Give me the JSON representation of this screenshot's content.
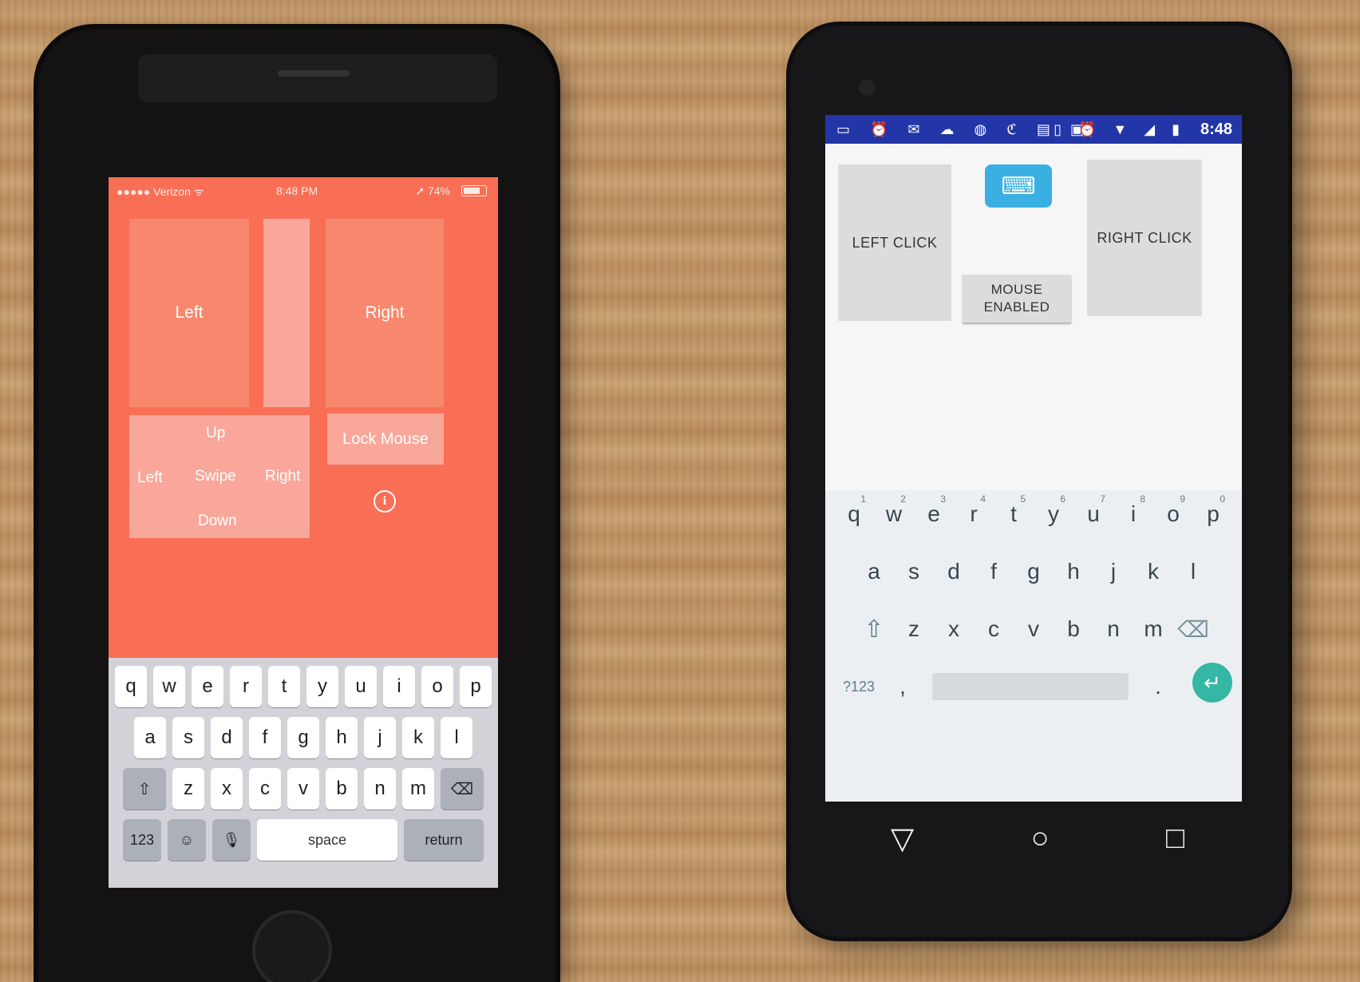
{
  "iphone": {
    "status": {
      "carrier": "●●●●● Verizon ᯤ",
      "time": "8:48 PM",
      "battery": "➚ 74%"
    },
    "pads": {
      "left": "Left",
      "right": "Right",
      "lock": "Lock Mouse"
    },
    "swipe": {
      "up": "Up",
      "left": "Left",
      "center": "Swipe",
      "right": "Right",
      "down": "Down"
    },
    "keyboard": {
      "row1": [
        "q",
        "w",
        "e",
        "r",
        "t",
        "y",
        "u",
        "i",
        "o",
        "p"
      ],
      "row2": [
        "a",
        "s",
        "d",
        "f",
        "g",
        "h",
        "j",
        "k",
        "l"
      ],
      "row3": [
        "z",
        "x",
        "c",
        "v",
        "b",
        "n",
        "m"
      ],
      "numbers": "123",
      "space": "space",
      "return": "return"
    }
  },
  "android": {
    "status": {
      "left_icons": "▭ ⏰ ✉ ☁ ◍ ℭ ▤ ▣",
      "right_icons": "▯ ⏰ ▼ ◢ ▮",
      "time": "8:48"
    },
    "buttons": {
      "left_click": "LEFT CLICK",
      "right_click": "RIGHT CLICK",
      "mouse_line1": "MOUSE",
      "mouse_line2": "ENABLED"
    },
    "keyboard": {
      "row1": [
        "q",
        "w",
        "e",
        "r",
        "t",
        "y",
        "u",
        "i",
        "o",
        "p"
      ],
      "row1_hints": [
        "1",
        "2",
        "3",
        "4",
        "5",
        "6",
        "7",
        "8",
        "9",
        "0"
      ],
      "row2": [
        "a",
        "s",
        "d",
        "f",
        "g",
        "h",
        "j",
        "k",
        "l"
      ],
      "row3": [
        "z",
        "x",
        "c",
        "v",
        "b",
        "n",
        "m"
      ],
      "symbols": "?123",
      "comma": ",",
      "period": "."
    }
  }
}
